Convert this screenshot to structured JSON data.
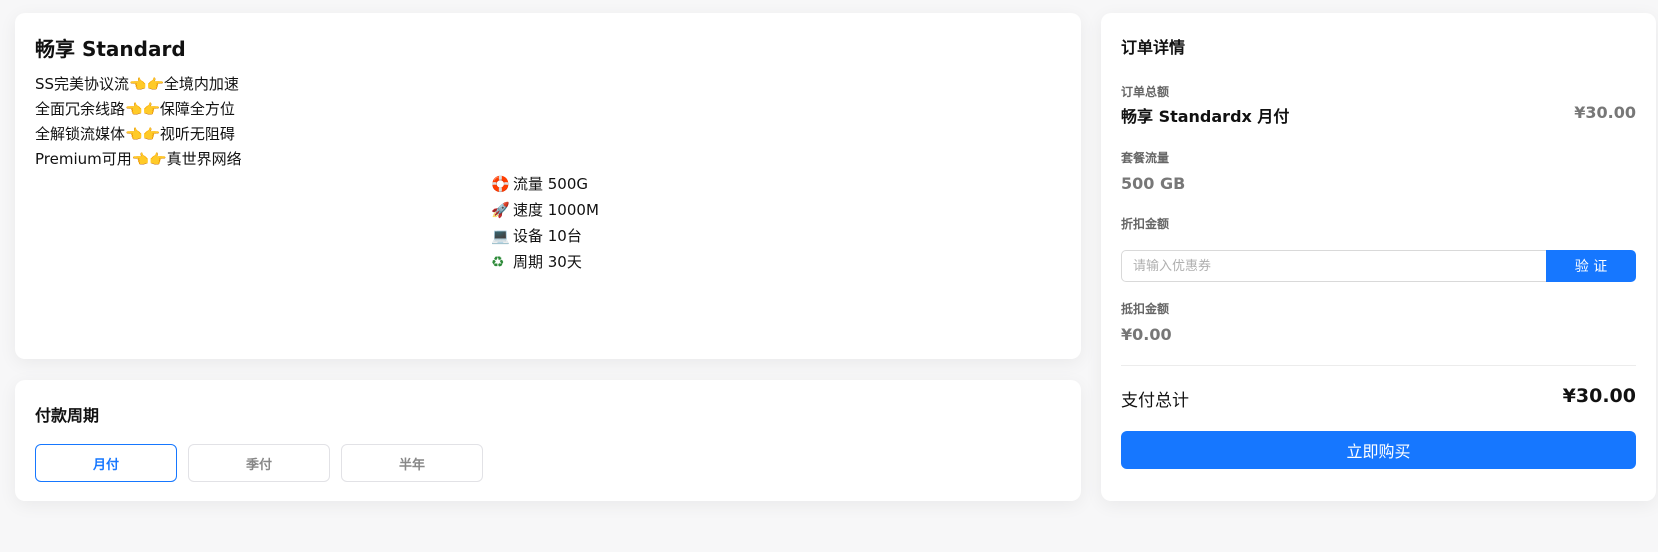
{
  "plan": {
    "title": "畅享 Standard",
    "features": [
      {
        "left": "SS完美协议流",
        "right": "全境内加速"
      },
      {
        "left": "全面冗余线路",
        "right": "保障全方位"
      },
      {
        "left": "全解锁流媒体",
        "right": "视听无阻碍"
      },
      {
        "left": "Premium可用",
        "right": "真世界网络"
      }
    ],
    "hands": [
      "👈",
      "👉"
    ],
    "specs": [
      {
        "icon": "🛟",
        "icon_name": "lifebuoy-icon",
        "text": "流量 500G"
      },
      {
        "icon": "🚀",
        "icon_name": "rocket-icon",
        "text": "速度 1000M"
      },
      {
        "icon": "💻",
        "icon_name": "laptop-icon",
        "text": "设备 10台"
      },
      {
        "icon": "♻",
        "icon_name": "recycle-icon",
        "text": "周期 30天"
      }
    ]
  },
  "period": {
    "title": "付款周期",
    "options": [
      "月付",
      "季付",
      "半年"
    ],
    "selected": "月付"
  },
  "order": {
    "title": "订单详情",
    "total_amount_label": "订单总额",
    "item_name": "畅享 Standardx 月付",
    "item_price": "¥30.00",
    "traffic_label": "套餐流量",
    "traffic_value": "500 GB",
    "discount_label": "折扣金额",
    "coupon_placeholder": "请输入优惠券",
    "verify_label": "验 证",
    "deduction_label": "抵扣金额",
    "deduction_value": "¥0.00",
    "total_label": "支付总计",
    "total_value": "¥30.00",
    "buy_label": "立即购买"
  },
  "colors": {
    "accent": "#1677ff",
    "background": "#f7f7f8"
  }
}
